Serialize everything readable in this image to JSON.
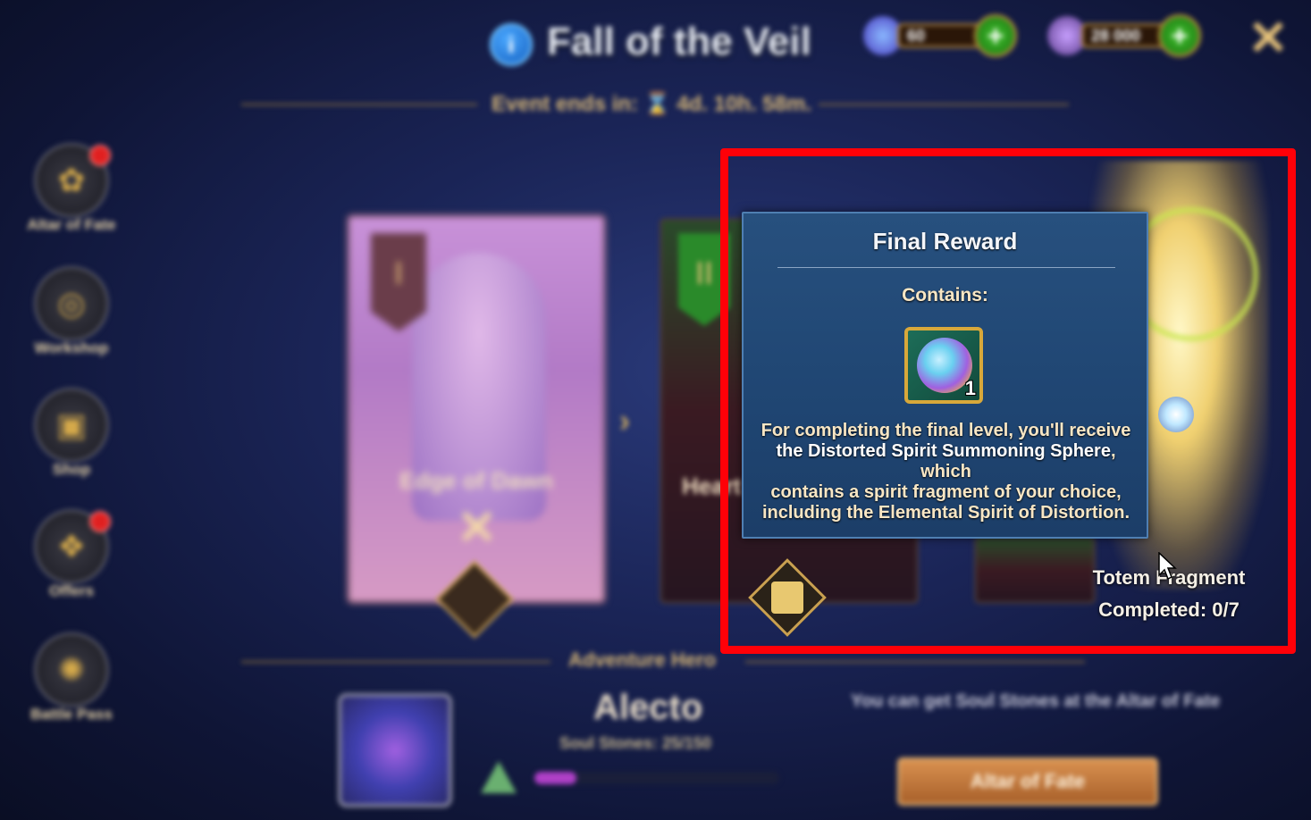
{
  "header": {
    "info_glyph": "i",
    "title": "Fall of the Veil",
    "event_ends": "Event ends in: ⌛ 4d. 10h. 58m.",
    "currency1": {
      "icon": "crystal-icon",
      "value": "60"
    },
    "currency2": {
      "icon": "coin-icon",
      "value": "28 000"
    },
    "plus_glyph": "+",
    "close_glyph": "✕"
  },
  "sidebar": {
    "items": [
      {
        "label": "Altar of Fate",
        "icon": "altar-icon",
        "badge": true
      },
      {
        "label": "Workshop",
        "icon": "workshop-icon",
        "badge": false
      },
      {
        "label": "Shop",
        "icon": "shop-icon",
        "badge": false
      },
      {
        "label": "Offers",
        "icon": "offers-icon",
        "badge": true
      },
      {
        "label": "Battle Pass",
        "icon": "battle-pass-icon",
        "badge": false
      }
    ]
  },
  "cards": [
    {
      "level": "I",
      "name": "Edge of Dawn",
      "completed_mark": "✕"
    },
    {
      "level": "II",
      "name": "Heart"
    }
  ],
  "totem": {
    "label": "Totem Fragment",
    "completed": "Completed: 0/7"
  },
  "popup": {
    "title": "Final Reward",
    "contains_label": "Contains:",
    "item": {
      "name": "Distorted Spirit Summoning Sphere",
      "count": "1"
    },
    "description_parts": [
      "For completing the final level, you'll receive",
      "the Distorted Spirit Summoning Sphere",
      ", which",
      "contains a spirit fragment of your choice,",
      "including the Elemental Spirit of Distortion."
    ]
  },
  "bottom": {
    "adventure_label": "Adventure Hero",
    "hero_name": "Alecto",
    "soul_stones": "Soul Stones: 25/150",
    "soul_progress": 0.17,
    "hint": "You can get Soul Stones at the Altar of Fate",
    "altar_button": "Altar of Fate"
  },
  "colors": {
    "highlight": "#ff0008",
    "popup_bg": "#27507e",
    "gold_text": "#f8e6c4"
  }
}
